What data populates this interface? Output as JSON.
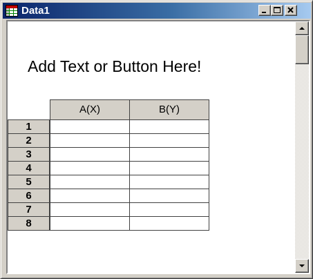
{
  "window": {
    "title": "Data1",
    "icon": "worksheet-grid-icon"
  },
  "title_buttons": [
    "minimize-icon",
    "maximize-icon",
    "close-icon"
  ],
  "sheet": {
    "header_text": "Add Text or Button Here!",
    "columns": [
      "A(X)",
      "B(Y)"
    ],
    "rows": [
      "1",
      "2",
      "3",
      "4",
      "5",
      "6",
      "7",
      "8"
    ]
  },
  "colors": {
    "title_bar_start": "#0a246a",
    "title_bar_end": "#a6caf0",
    "face": "#d4d0c8"
  }
}
